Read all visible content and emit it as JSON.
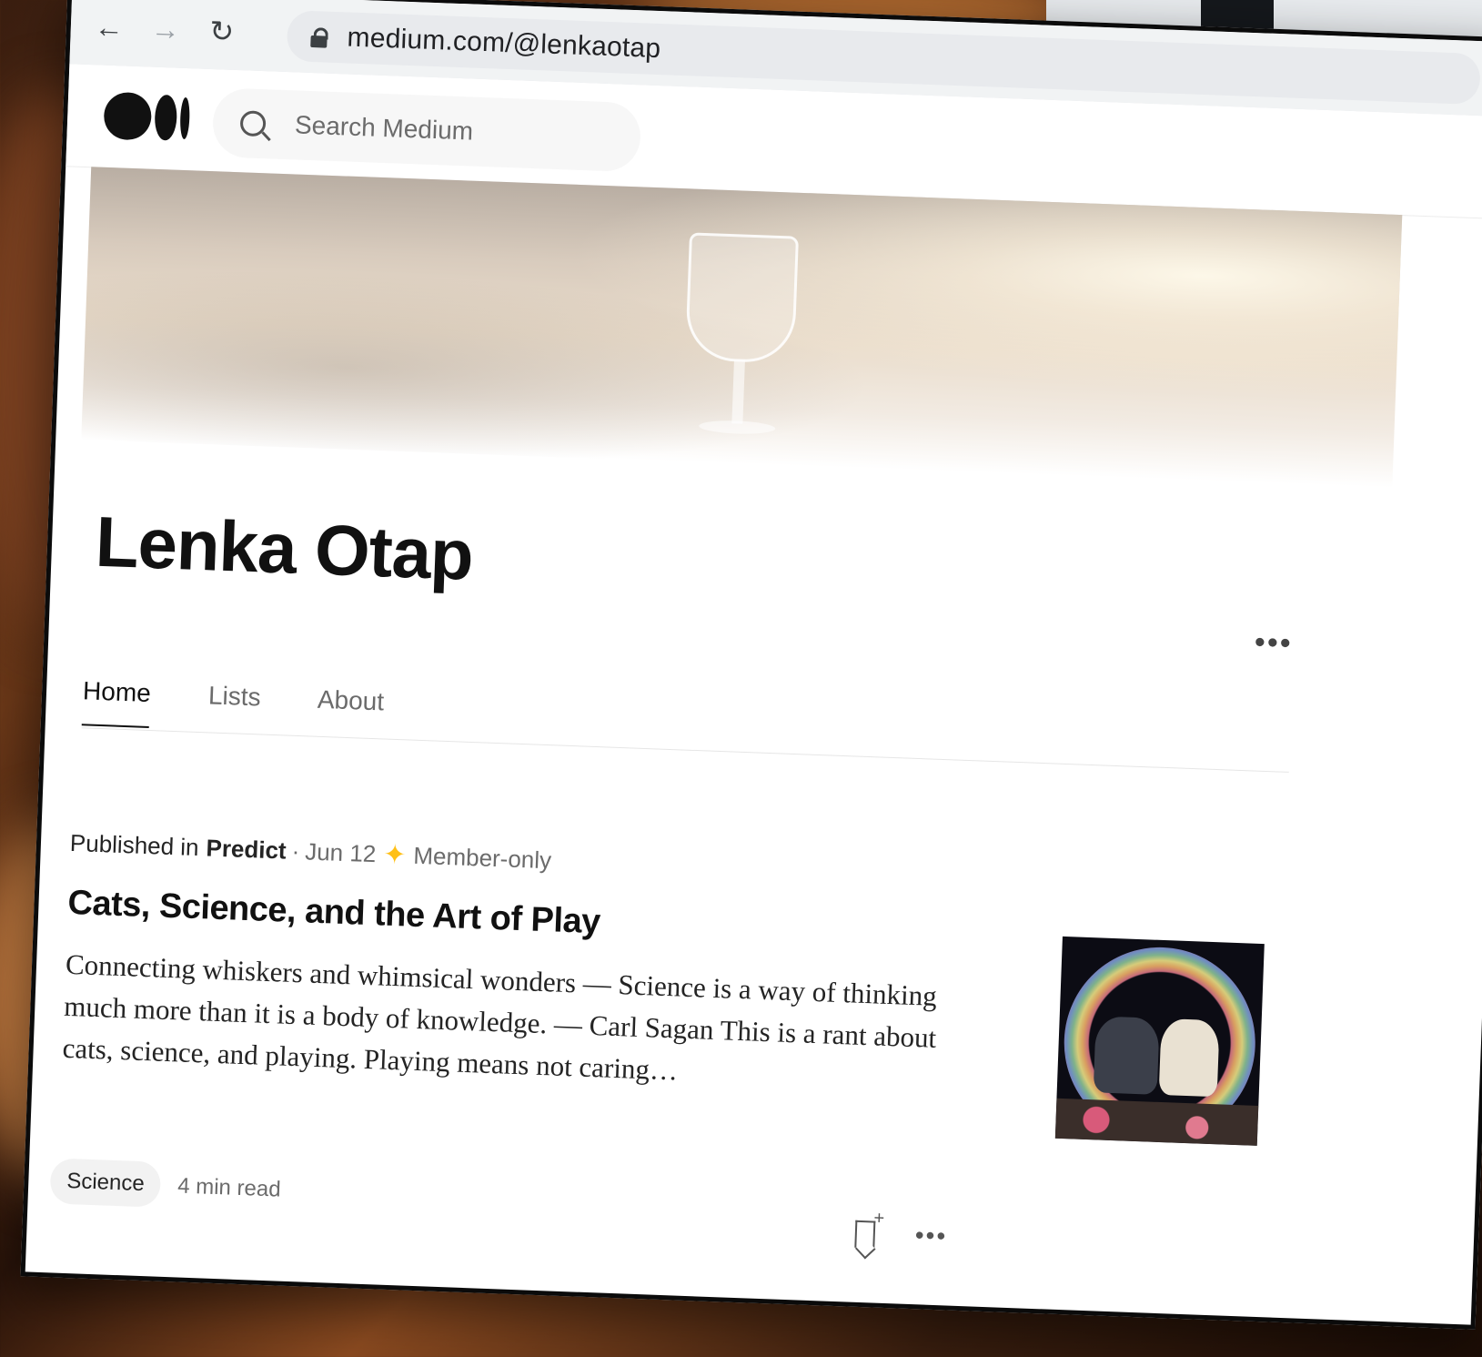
{
  "browser": {
    "url": "medium.com/@lenkaotap"
  },
  "header": {
    "search_placeholder": "Search Medium"
  },
  "profile": {
    "name": "Lenka Otap",
    "more": "•••"
  },
  "tabs": [
    {
      "label": "Home",
      "active": true
    },
    {
      "label": "Lists",
      "active": false
    },
    {
      "label": "About",
      "active": false
    }
  ],
  "post": {
    "published_in_prefix": "Published in",
    "publication": "Predict",
    "separator": "·",
    "date": "Jun 12",
    "member_label": "Member-only",
    "title": "Cats, Science, and the Art of Play",
    "excerpt": "Connecting whiskers and whimsical wonders — Science is a way of thinking much more than it is a body of knowledge. — Carl Sagan This is a rant about cats, science, and playing. Playing means not caring…",
    "tag": "Science",
    "read_time": "4 min read",
    "bookmark_plus": "+",
    "more": "•••"
  },
  "colors": {
    "member_star": "#ffc017",
    "text_primary": "#242424",
    "text_secondary": "#6b6b6b"
  },
  "icons": [
    "back-arrow-icon",
    "forward-arrow-icon",
    "reload-icon",
    "lock-icon",
    "medium-logo",
    "search-icon",
    "star-icon",
    "bookmark-icon",
    "more-icon"
  ]
}
